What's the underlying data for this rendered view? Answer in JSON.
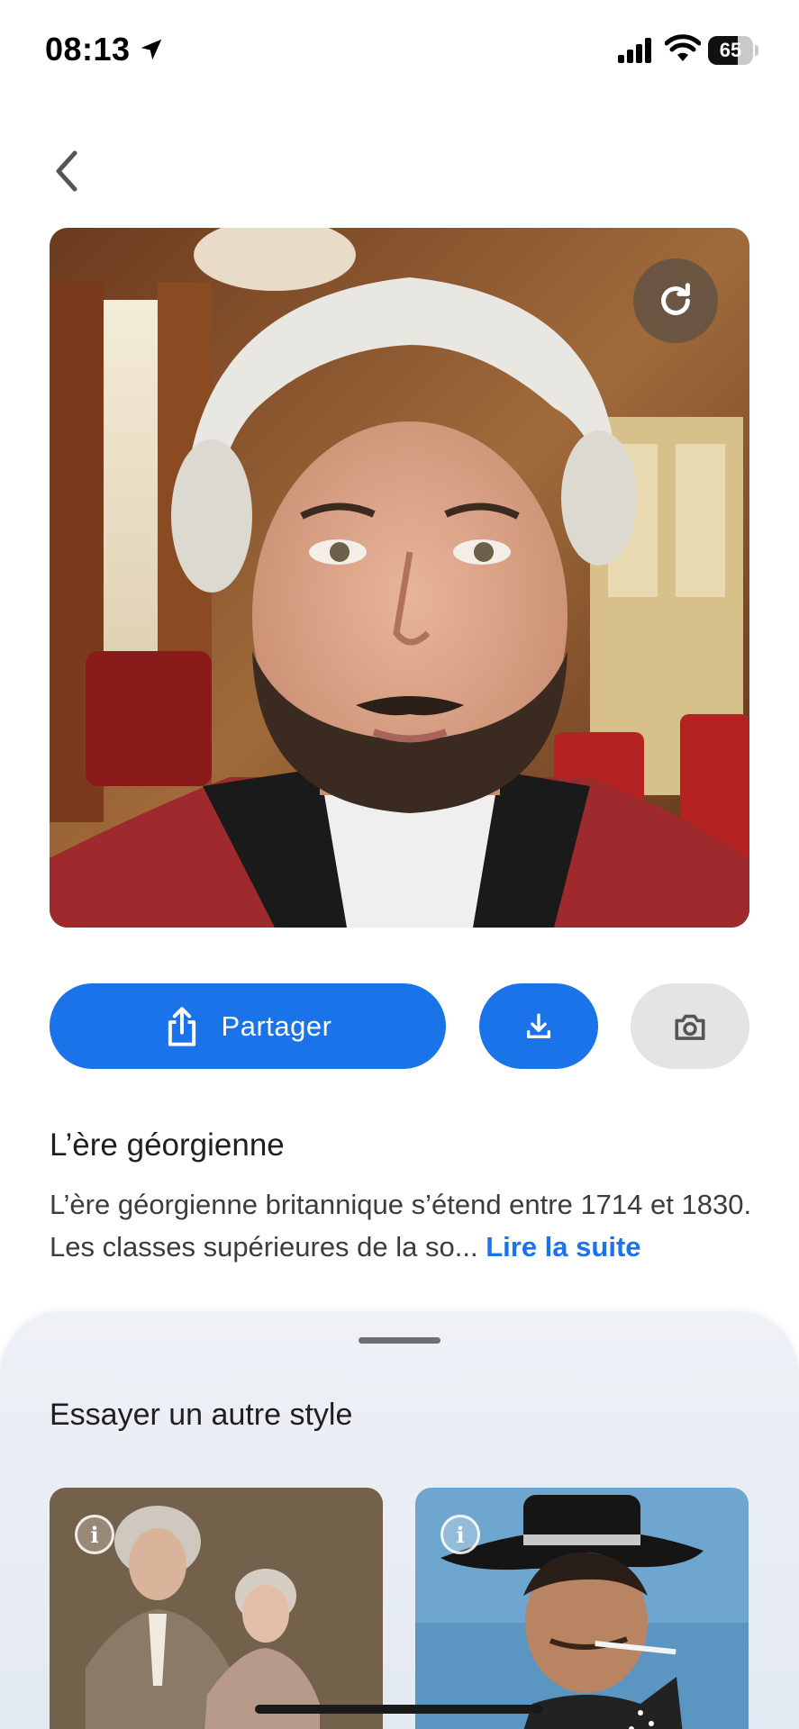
{
  "status_bar": {
    "time": "08:13",
    "battery_level": "65",
    "icons": [
      "location-arrow-icon",
      "cellular-signal-icon",
      "wifi-icon",
      "battery-icon"
    ]
  },
  "nav": {
    "back_icon": "chevron-left-icon"
  },
  "hero": {
    "regenerate_icon": "refresh-icon"
  },
  "actions": {
    "share_label": "Partager",
    "share_icon": "share-icon",
    "download_icon": "download-icon",
    "camera_icon": "camera-icon"
  },
  "info": {
    "title": "L’ère géorgienne",
    "text": "L’ère géorgienne britannique s’étend entre 1714 et 1830. Les classes supérieures de la so...",
    "read_more": "Lire la suite"
  },
  "sheet": {
    "title": "Essayer un autre style",
    "cards": [
      {
        "info_icon": "info-icon"
      },
      {
        "info_icon": "info-icon"
      }
    ]
  },
  "colors": {
    "accent": "#1a73e8",
    "camera_button_bg": "#e4e4e4",
    "sheet_bg": "#eef1f6"
  }
}
